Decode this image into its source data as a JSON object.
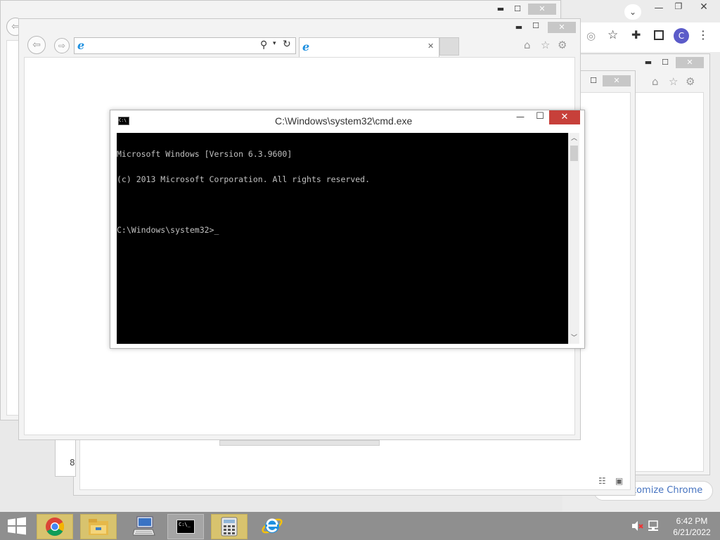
{
  "cmd": {
    "title": "C:\\Windows\\system32\\cmd.exe",
    "console_lines": [
      "Microsoft Windows [Version 6.3.9600]",
      "(c) 2013 Microsoft Corporation. All rights reserved.",
      "",
      "C:\\Windows\\system32>"
    ],
    "cursor": "_"
  },
  "chrome": {
    "avatar_letter": "C",
    "customize_label": "tomize Chrome"
  },
  "partial_text": {
    "bottom_left_digit": "8"
  },
  "taskbar": {
    "items": [
      {
        "name": "start",
        "icon": "windows-logo-icon"
      },
      {
        "name": "chrome",
        "icon": "chrome-icon"
      },
      {
        "name": "file-explorer",
        "icon": "folder-icon"
      },
      {
        "name": "remote-desktop",
        "icon": "computer-keyboard-icon"
      },
      {
        "name": "cmd",
        "icon": "cmd-icon",
        "icon_text": "C:\\_"
      },
      {
        "name": "calculator",
        "icon": "calculator-icon"
      },
      {
        "name": "internet-explorer",
        "icon": "ie-icon"
      }
    ],
    "clock_time": "6:42 PM",
    "clock_date": "6/21/2022"
  },
  "colors": {
    "close_red": "#c7403a",
    "taskbar": "#8f8f8f",
    "console_bg": "#000000",
    "console_text": "#c0c0c0",
    "chrome_avatar": "#5b5bc9",
    "help_blue": "#1e74d2"
  }
}
